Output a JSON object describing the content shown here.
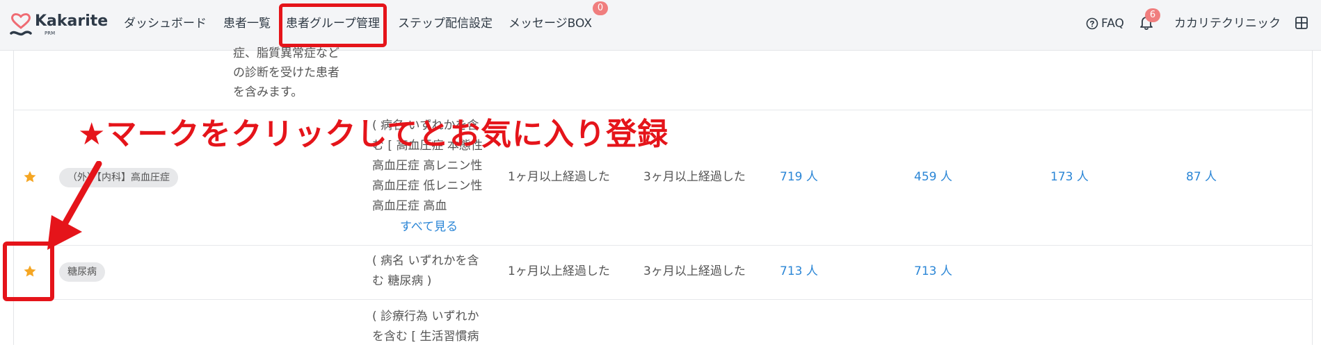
{
  "nav": {
    "brand": "Kakarite",
    "brand_sub": "PRM",
    "items": [
      {
        "label": "ダッシュボード"
      },
      {
        "label": "患者一覧"
      },
      {
        "label": "患者グループ管理"
      },
      {
        "label": "ステップ配信設定"
      },
      {
        "label": "メッセージBOX"
      }
    ],
    "message_badge": "0",
    "faq_label": "FAQ",
    "notification_badge": "6",
    "clinic_name": "カカリテクリニック"
  },
  "rows": {
    "top_partial": {
      "desc_lines": [
        "症、脂質異常症など",
        "の診断を受けた患者",
        "を含みます。"
      ]
    },
    "hypertension": {
      "tag": "（外）【内科】高血圧症",
      "condition_lines": [
        "( 病名 いずれかを含",
        "む [ 高血圧症 本態性",
        "高血圧症 高レニン性",
        "高血圧症 低レニン性",
        "高血圧症 高血"
      ],
      "see_all": "すべて見る",
      "elapsed1": "1ヶ月以上経過した",
      "elapsed2": "3ヶ月以上経過した",
      "counts": [
        "719 人",
        "459 人",
        "173 人",
        "87 人"
      ]
    },
    "diabetes": {
      "tag": "糖尿病",
      "condition_lines": [
        "( 病名 いずれかを含",
        "む 糖尿病 )"
      ],
      "elapsed1": "1ヶ月以上経過した",
      "elapsed2": "3ヶ月以上経過した",
      "counts": [
        "713 人",
        "713 人"
      ]
    },
    "bottom_partial": {
      "condition_lines": [
        "( 診療行為 いずれか",
        "を含む [ 生活習慣病"
      ]
    }
  },
  "annotation": {
    "text": "★マークをクリックしてとお気に入り登録"
  },
  "colors": {
    "accent_red": "#e5141a",
    "link_blue": "#2b86d6",
    "star_orange": "#f5a623",
    "logo_pink": "#ef6b73",
    "logo_navy": "#2e3a48"
  }
}
